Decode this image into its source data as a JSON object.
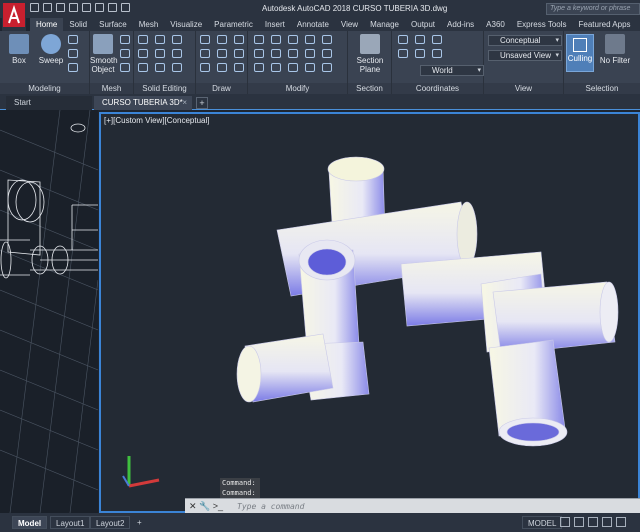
{
  "app": {
    "title": "Autodesk AutoCAD 2018     CURSO TUBERIA 3D.dwg",
    "search_placeholder": "Type a keyword or phrase"
  },
  "ribbon_tabs": [
    "Home",
    "Solid",
    "Surface",
    "Mesh",
    "Visualize",
    "Parametric",
    "Insert",
    "Annotate",
    "View",
    "Manage",
    "Output",
    "Add-ins",
    "A360",
    "Express Tools",
    "Featured Apps"
  ],
  "ribbon": {
    "box_label": "Box",
    "sweep_label": "Sweep",
    "smooth_object_label": "Smooth Object",
    "section_plane_label": "Section Plane",
    "culling_label": "Culling",
    "no_filter_label": "No Filter",
    "visual_style_value": "Conceptual",
    "view_value": "Unsaved View",
    "ucs_value": "World",
    "panels": {
      "modeling": "Modeling",
      "mesh": "Mesh",
      "solid_editing": "Solid Editing",
      "draw": "Draw",
      "modify": "Modify",
      "section": "Section",
      "coordinates": "Coordinates",
      "view": "View",
      "selection": "Selection"
    }
  },
  "doc_tabs": {
    "start": "Start",
    "active": "CURSO TUBERIA 3D*"
  },
  "viewport": {
    "label": "[+][Custom View][Conceptual]"
  },
  "command": {
    "history": [
      "Command:",
      "Command:"
    ],
    "placeholder": "Type a command"
  },
  "status": {
    "layout_tabs": [
      "Model",
      "Layout1",
      "Layout2"
    ],
    "model_label": "MODEL"
  },
  "colors": {
    "viewport_border": "#3b84d6",
    "pipe_light": "#f2f3df",
    "pipe_shadow": "#6f6fe0"
  }
}
